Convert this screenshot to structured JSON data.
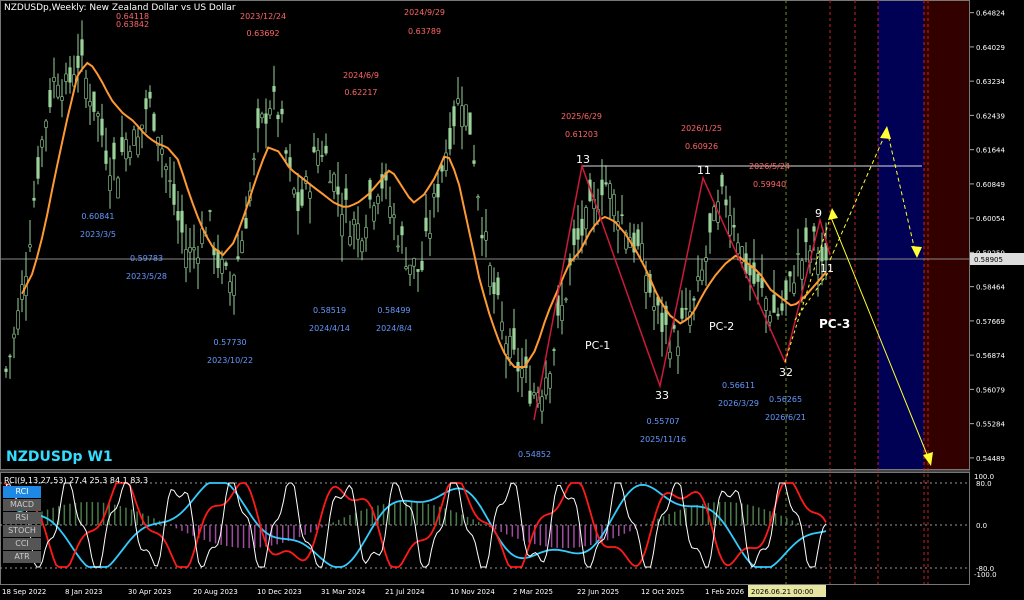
{
  "header": {
    "title": "NZDUSDp,Weekly:  New Zealand Dollar vs US Dollar"
  },
  "symbol_label": "NZDUSDp W1",
  "current_price": "0.58905",
  "chart_data": {
    "type": "line",
    "title": "NZDUSDp,Weekly:  New Zealand Dollar vs US Dollar",
    "ylim": [
      0.54208,
      0.65118
    ],
    "y_ticks": [
      "0.64824",
      "0.64029",
      "0.63234",
      "0.62439",
      "0.61644",
      "0.60849",
      "0.60054",
      "0.59259",
      "0.58464",
      "0.57669",
      "0.56874",
      "0.56079",
      "0.55284",
      "0.54489"
    ],
    "x_ticks": [
      "18 Sep 2022",
      "8 Jan 2023",
      "30 Apr 2023",
      "20 Aug 2023",
      "10 Dec 2023",
      "31 Mar 2024",
      "21 Jul 2024",
      "10 Nov 2024",
      "2 Mar 2025",
      "22 Jun 2025",
      "12 Oct 2025",
      "1 Feb 2026"
    ],
    "price_series": {
      "name": "Close (bars)",
      "values": [
        0.565,
        0.575,
        0.59,
        0.61,
        0.625,
        0.635,
        0.63,
        0.638,
        0.632,
        0.625,
        0.615,
        0.612,
        0.62,
        0.618,
        0.628,
        0.622,
        0.61,
        0.6,
        0.592,
        0.595,
        0.6,
        0.59,
        0.585,
        0.592,
        0.605,
        0.62,
        0.628,
        0.625,
        0.61,
        0.602,
        0.61,
        0.618,
        0.613,
        0.605,
        0.6,
        0.598,
        0.605,
        0.61,
        0.603,
        0.595,
        0.59,
        0.588,
        0.6,
        0.612,
        0.622,
        0.63,
        0.62,
        0.6,
        0.585,
        0.575,
        0.568,
        0.565,
        0.56,
        0.562,
        0.57,
        0.58,
        0.592,
        0.598,
        0.602,
        0.61,
        0.605,
        0.6,
        0.595,
        0.59,
        0.58,
        0.575,
        0.572,
        0.576,
        0.58,
        0.59,
        0.6,
        0.606,
        0.6,
        0.59,
        0.585,
        0.582,
        0.578,
        0.58,
        0.59,
        0.592,
        0.595,
        0.588
      ]
    },
    "ma_series": {
      "name": "MA",
      "values": [
        0.583,
        0.588,
        0.598,
        0.611,
        0.623,
        0.634,
        0.637,
        0.633,
        0.628,
        0.625,
        0.623,
        0.62,
        0.618,
        0.617,
        0.614,
        0.606,
        0.599,
        0.594,
        0.592,
        0.595,
        0.602,
        0.61,
        0.617,
        0.616,
        0.612,
        0.61,
        0.608,
        0.606,
        0.604,
        0.603,
        0.604,
        0.606,
        0.609,
        0.612,
        0.608,
        0.604,
        0.606,
        0.61,
        0.616,
        0.61,
        0.598,
        0.586,
        0.577,
        0.57,
        0.566,
        0.566,
        0.57,
        0.578,
        0.584,
        0.59,
        0.593,
        0.598,
        0.601,
        0.6,
        0.597,
        0.593,
        0.588,
        0.582,
        0.578,
        0.576,
        0.578,
        0.583,
        0.587,
        0.59,
        0.592,
        0.59,
        0.588,
        0.584,
        0.582,
        0.58,
        0.582,
        0.585,
        0.588
      ]
    },
    "swing_points": [
      {
        "label": "13",
        "value": 0.61203
      },
      {
        "label": "33",
        "value": 0.55707
      },
      {
        "label": "11",
        "value": 0.60926
      },
      {
        "label": "32",
        "value": 0.56265
      },
      {
        "label": "9",
        "value": 0.5994
      }
    ],
    "annotations_top": [
      {
        "price": "0.63842",
        "date": ""
      },
      {
        "price": "0.64118",
        "date": ""
      },
      {
        "price": "0.63692",
        "date": "2023/12/24"
      },
      {
        "price": "0.62217",
        "date": "2024/6/9"
      },
      {
        "price": "0.63789",
        "date": "2024/9/29"
      },
      {
        "price": "0.61203",
        "date": "2025/6/29"
      },
      {
        "price": "0.60926",
        "date": "2026/1/25"
      },
      {
        "price": "0.59940",
        "date": "2026/5/24"
      }
    ],
    "annotations_bottom": [
      {
        "price": "0.60841",
        "date": "2023/3/5"
      },
      {
        "price": "0.59783",
        "date": "2023/5/28"
      },
      {
        "price": "0.57730",
        "date": "2023/10/22"
      },
      {
        "price": "0.58519",
        "date": "2024/4/14"
      },
      {
        "price": "0.58499",
        "date": "2024/8/4"
      },
      {
        "price": "0.54852",
        "date": ""
      },
      {
        "price": "0.55707",
        "date": "2025/11/16"
      },
      {
        "price": "0.56611",
        "date": "2026/3/29"
      },
      {
        "price": "0.56265",
        "date": "2026/6/21"
      }
    ],
    "pattern_labels": [
      "PC-1",
      "PC-2",
      "PC-3"
    ],
    "projection_markers": [
      "11"
    ],
    "indicator": {
      "name": "RCI(9,13,27,53) 27.4 25.3 84.1 83.3",
      "levels": [
        "100.0",
        "80.0",
        "0.0",
        "-80.0",
        "-100.0"
      ],
      "series": [
        {
          "name": "RCI 9",
          "color": "#ffffff"
        },
        {
          "name": "RCI 13",
          "color": "#ff1a1a"
        },
        {
          "name": "RCI 27",
          "color": "#33ccff"
        }
      ]
    }
  },
  "indicator_buttons": [
    "RCI",
    "MACD",
    "RSI",
    "STOCH",
    "CCI",
    "ATR"
  ],
  "crosshair_time": "2026.06.21 00:00",
  "colors": {
    "bg": "#000000",
    "bull": "#9ad29a",
    "ma": "#ff9933",
    "zigzag": "#cc1a3a",
    "red_text": "#ff6666",
    "blue_text": "#6699ff",
    "projection": "#ffff33",
    "zone_blue": "#000055",
    "zone_brown": "#330000"
  }
}
